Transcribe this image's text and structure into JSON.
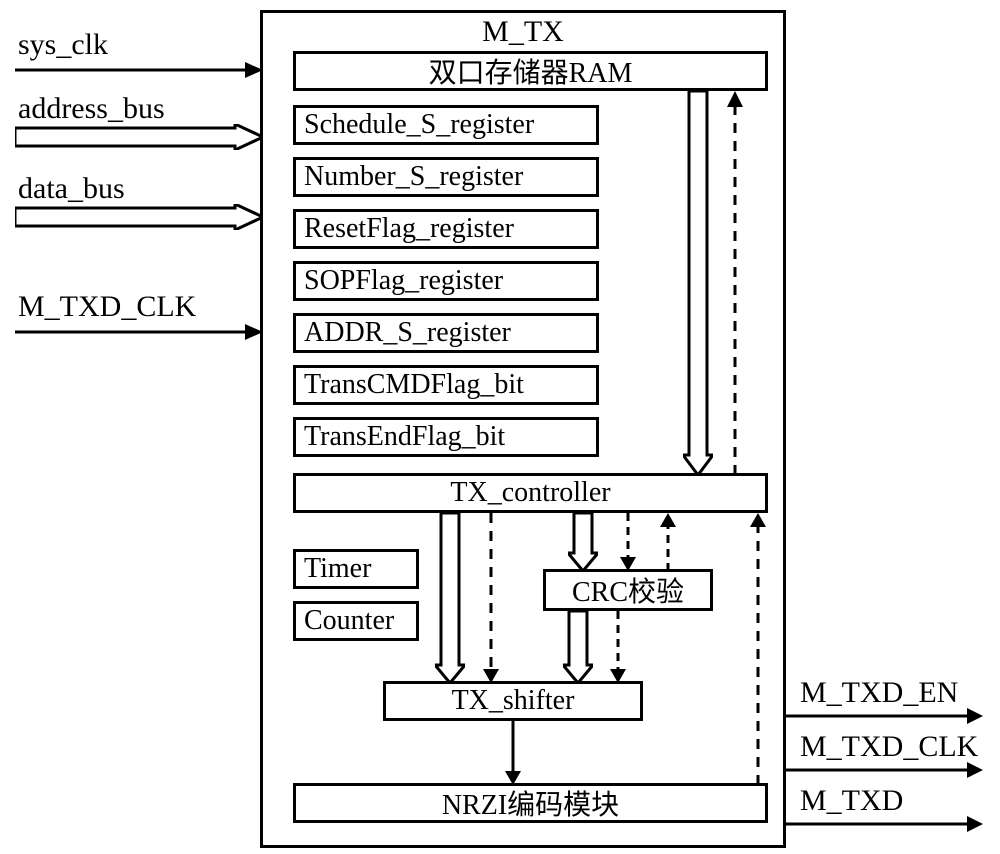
{
  "title": "M_TX",
  "inputs": {
    "sys_clk": "sys_clk",
    "address_bus": "address_bus",
    "data_bus": "data_bus",
    "m_txd_clk": "M_TXD_CLK"
  },
  "outputs": {
    "m_txd_en": "M_TXD_EN",
    "m_txd_clk": "M_TXD_CLK",
    "m_txd": "M_TXD"
  },
  "blocks": {
    "ram": "双口存储器RAM",
    "schedule": "Schedule_S_register",
    "number": "Number_S_register",
    "resetflag": "ResetFlag_register",
    "sopflag": "SOPFlag_register",
    "addr": "ADDR_S_register",
    "transcmd": "TransCMDFlag_bit",
    "transend": "TransEndFlag_bit",
    "controller": "TX_controller",
    "timer": "Timer",
    "counter": "Counter",
    "crc": "CRC校验",
    "shifter": "TX_shifter",
    "nrzi": "NRZI编码模块"
  }
}
